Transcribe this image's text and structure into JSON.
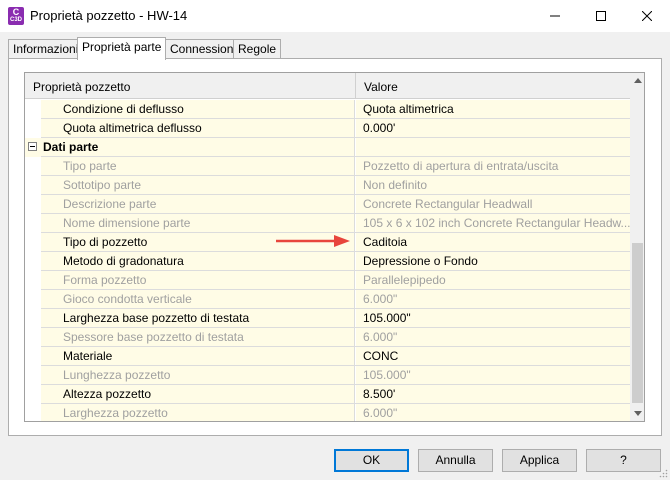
{
  "window": {
    "title": "Proprietà pozzetto - HW-14",
    "app_icon_lines": [
      "C",
      "C3D"
    ],
    "controls": [
      "minimize-icon",
      "maximize-icon",
      "close-icon"
    ]
  },
  "tabs": [
    {
      "label": "Informazioni",
      "active": false
    },
    {
      "label": "Proprietà parte",
      "active": true
    },
    {
      "label": "Connessioni",
      "active": false
    },
    {
      "label": "Regole",
      "active": false
    }
  ],
  "grid": {
    "header_name": "Proprietà pozzetto",
    "header_value": "Valore",
    "rows": [
      {
        "name": "Condizione di deflusso",
        "value": "Quota altimetrica",
        "disabled": false
      },
      {
        "name": "Quota altimetrica deflusso",
        "value": "0.000'",
        "disabled": false
      },
      {
        "category": "Dati parte"
      },
      {
        "name": "Tipo parte",
        "value": "Pozzetto di apertura di entrata/uscita",
        "disabled": true
      },
      {
        "name": "Sottotipo parte",
        "value": "Non definito",
        "disabled": true
      },
      {
        "name": "Descrizione parte",
        "value": "Concrete Rectangular Headwall",
        "disabled": true
      },
      {
        "name": "Nome dimensione parte",
        "value": "105 x 6 x 102 inch Concrete Rectangular Headw...",
        "disabled": true
      },
      {
        "name": "Tipo di pozzetto",
        "value": "Caditoia",
        "disabled": false
      },
      {
        "name": "Metodo di gradonatura",
        "value": "Depressione o Fondo",
        "disabled": false
      },
      {
        "name": "Forma pozzetto",
        "value": "Parallelepipedo",
        "disabled": true
      },
      {
        "name": "Gioco condotta verticale",
        "value": "6.000\"",
        "disabled": true
      },
      {
        "name": "Larghezza base pozzetto di testata",
        "value": "105.000\"",
        "disabled": false
      },
      {
        "name": "Spessore base pozzetto di testata",
        "value": "6.000\"",
        "disabled": true
      },
      {
        "name": "Materiale",
        "value": "CONC",
        "disabled": false
      },
      {
        "name": "Lunghezza pozzetto",
        "value": "105.000\"",
        "disabled": true
      },
      {
        "name": "Altezza pozzetto",
        "value": "8.500'",
        "disabled": false
      },
      {
        "name": "Larghezza pozzetto",
        "value": "6.000\"",
        "disabled": true
      }
    ]
  },
  "buttons": {
    "ok": "OK",
    "cancel": "Annulla",
    "apply": "Applica",
    "help": "?"
  },
  "colors": {
    "accent": "#0078d7",
    "row_background": "#fffce6",
    "disabled_text": "#a0a0a0",
    "annotation_arrow": "#e8453c"
  },
  "icons": {
    "expander": "collapse-icon",
    "annotation": "red-arrow-icon"
  }
}
